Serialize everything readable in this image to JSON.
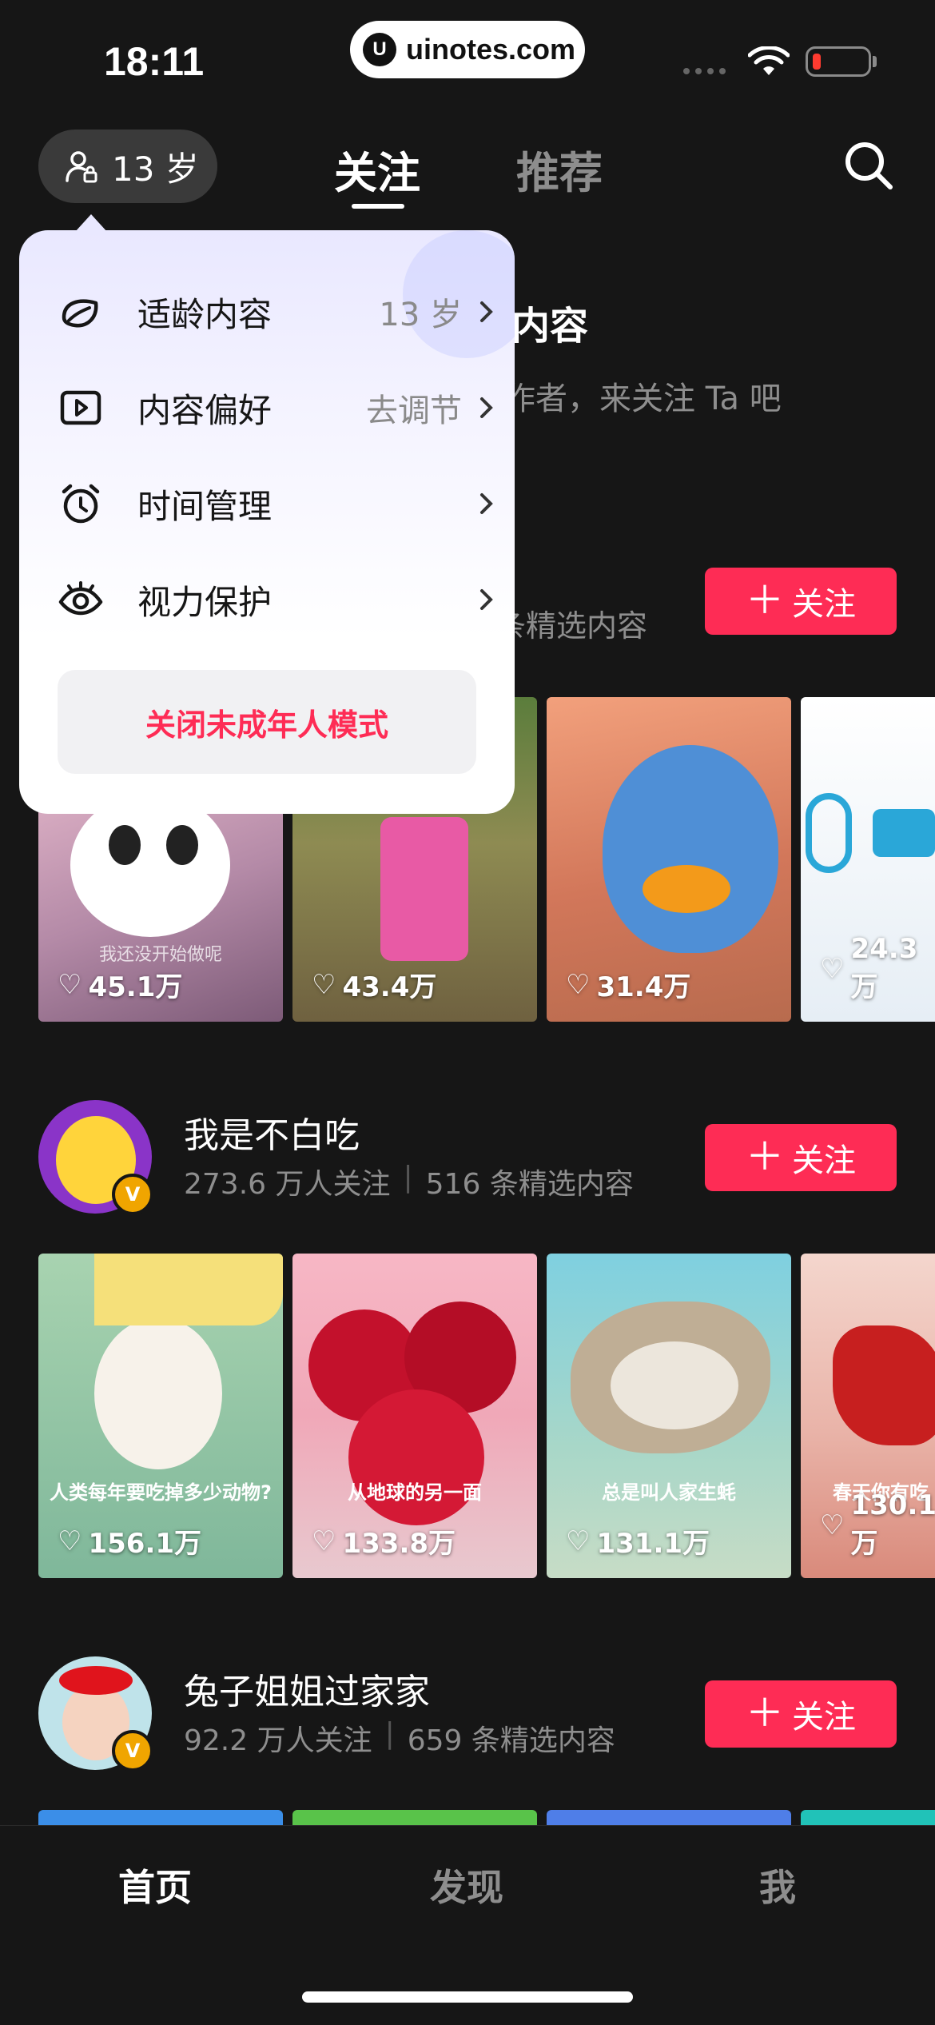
{
  "status_bar": {
    "time": "18:11",
    "url": "uinotes.com"
  },
  "header": {
    "age_label": "13 岁",
    "tabs": [
      {
        "label": "关注",
        "active": true
      },
      {
        "label": "推荐",
        "active": false
      }
    ]
  },
  "popover": {
    "items": [
      {
        "label": "适龄内容",
        "value": "13 岁",
        "icon": "leaf-icon"
      },
      {
        "label": "内容偏好",
        "value": "去调节",
        "icon": "play-square-icon"
      },
      {
        "label": "时间管理",
        "value": "",
        "icon": "alarm-clock-icon"
      },
      {
        "label": "视力保护",
        "value": "",
        "icon": "eye-icon"
      }
    ],
    "close_label": "关闭未成年人模式"
  },
  "background_partial": {
    "heading_tail": "内容",
    "sub_tail": "作者，来关注 Ta 吧",
    "meta_tail": "条精选内容"
  },
  "follow_label": "关注",
  "creators": [
    {
      "name": "",
      "meta": "",
      "videos": [
        {
          "likes": "45.1万",
          "caption": "我还没开始做呢"
        },
        {
          "likes": "43.4万",
          "caption": ""
        },
        {
          "likes": "31.4万",
          "caption": ""
        },
        {
          "likes": "24.3万",
          "caption": ""
        }
      ]
    },
    {
      "name": "我是不白吃",
      "followers": "273.6 万人关注",
      "posts": "516 条精选内容",
      "videos": [
        {
          "likes": "156.1万",
          "caption": "人类每年要吃掉多少动物?"
        },
        {
          "likes": "133.8万",
          "caption": "从地球的另一面"
        },
        {
          "likes": "131.1万",
          "caption": "总是叫人家生蚝"
        },
        {
          "likes": "130.1万",
          "caption": "春天你有吃"
        }
      ]
    },
    {
      "name": "兔子姐姐过家家",
      "followers": "92.2 万人关注",
      "posts": "659 条精选内容",
      "videos": []
    }
  ],
  "tabbar": {
    "home": "首页",
    "discover": "发现",
    "me": "我"
  },
  "colors": {
    "accent": "#fe2c55",
    "bg": "#161616"
  }
}
